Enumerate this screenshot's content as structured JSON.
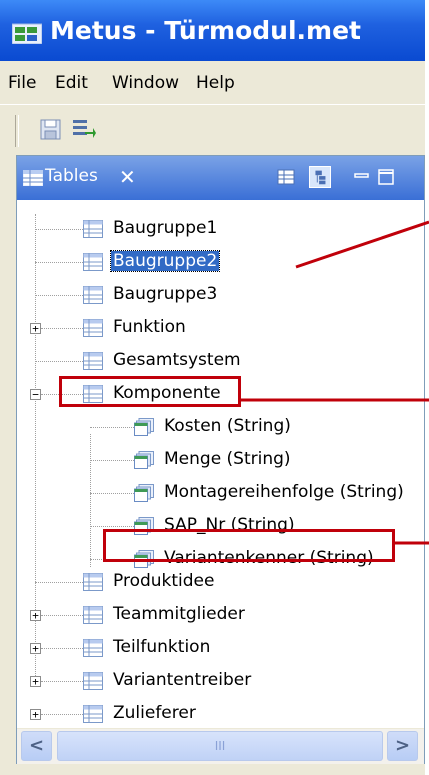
{
  "window": {
    "title": "Metus - Türmodul.met",
    "accent": "#1f61e0"
  },
  "menu": [
    "File",
    "Edit",
    "Window",
    "Help"
  ],
  "toolbar": {
    "buttons": [
      "save-icon",
      "import-icon"
    ]
  },
  "view": {
    "tab_label": "Tables",
    "tab_close": "✕",
    "header_buttons": [
      "table-icon",
      "tree-icon",
      "minimize-icon",
      "maximize-icon"
    ]
  },
  "tree": {
    "items": [
      {
        "label": "Baugruppe1",
        "expandable": false,
        "selected": false
      },
      {
        "label": "Baugruppe2",
        "expandable": false,
        "selected": true
      },
      {
        "label": "Baugruppe3",
        "expandable": false,
        "selected": false
      },
      {
        "label": "Funktion",
        "expandable": true,
        "expanded": false
      },
      {
        "label": "Gesamtsystem",
        "expandable": false
      },
      {
        "label": "Komponente",
        "expandable": true,
        "expanded": true,
        "highlighted": true
      },
      {
        "label": "Kosten (String)",
        "child": true
      },
      {
        "label": "Menge (String)",
        "child": true
      },
      {
        "label": "Montagereihenfolge (String)",
        "child": true
      },
      {
        "label": "SAP_Nr (String)",
        "child": true
      },
      {
        "label": "Variantenkenner (String)",
        "child": true,
        "highlighted": true
      },
      {
        "label": "Produktidee",
        "expandable": false
      },
      {
        "label": "Teammitglieder",
        "expandable": true,
        "expanded": false
      },
      {
        "label": "Teilfunktion",
        "expandable": true,
        "expanded": false
      },
      {
        "label": "Variantentreiber",
        "expandable": true,
        "expanded": false
      },
      {
        "label": "Zulieferer",
        "expandable": true,
        "expanded": false
      }
    ]
  },
  "scrollbar": {
    "left_arrow": "<",
    "right_arrow": ">",
    "thumb_grip": "III"
  },
  "colors": {
    "selection": "#316ac5",
    "annotation": "#c0000a"
  }
}
